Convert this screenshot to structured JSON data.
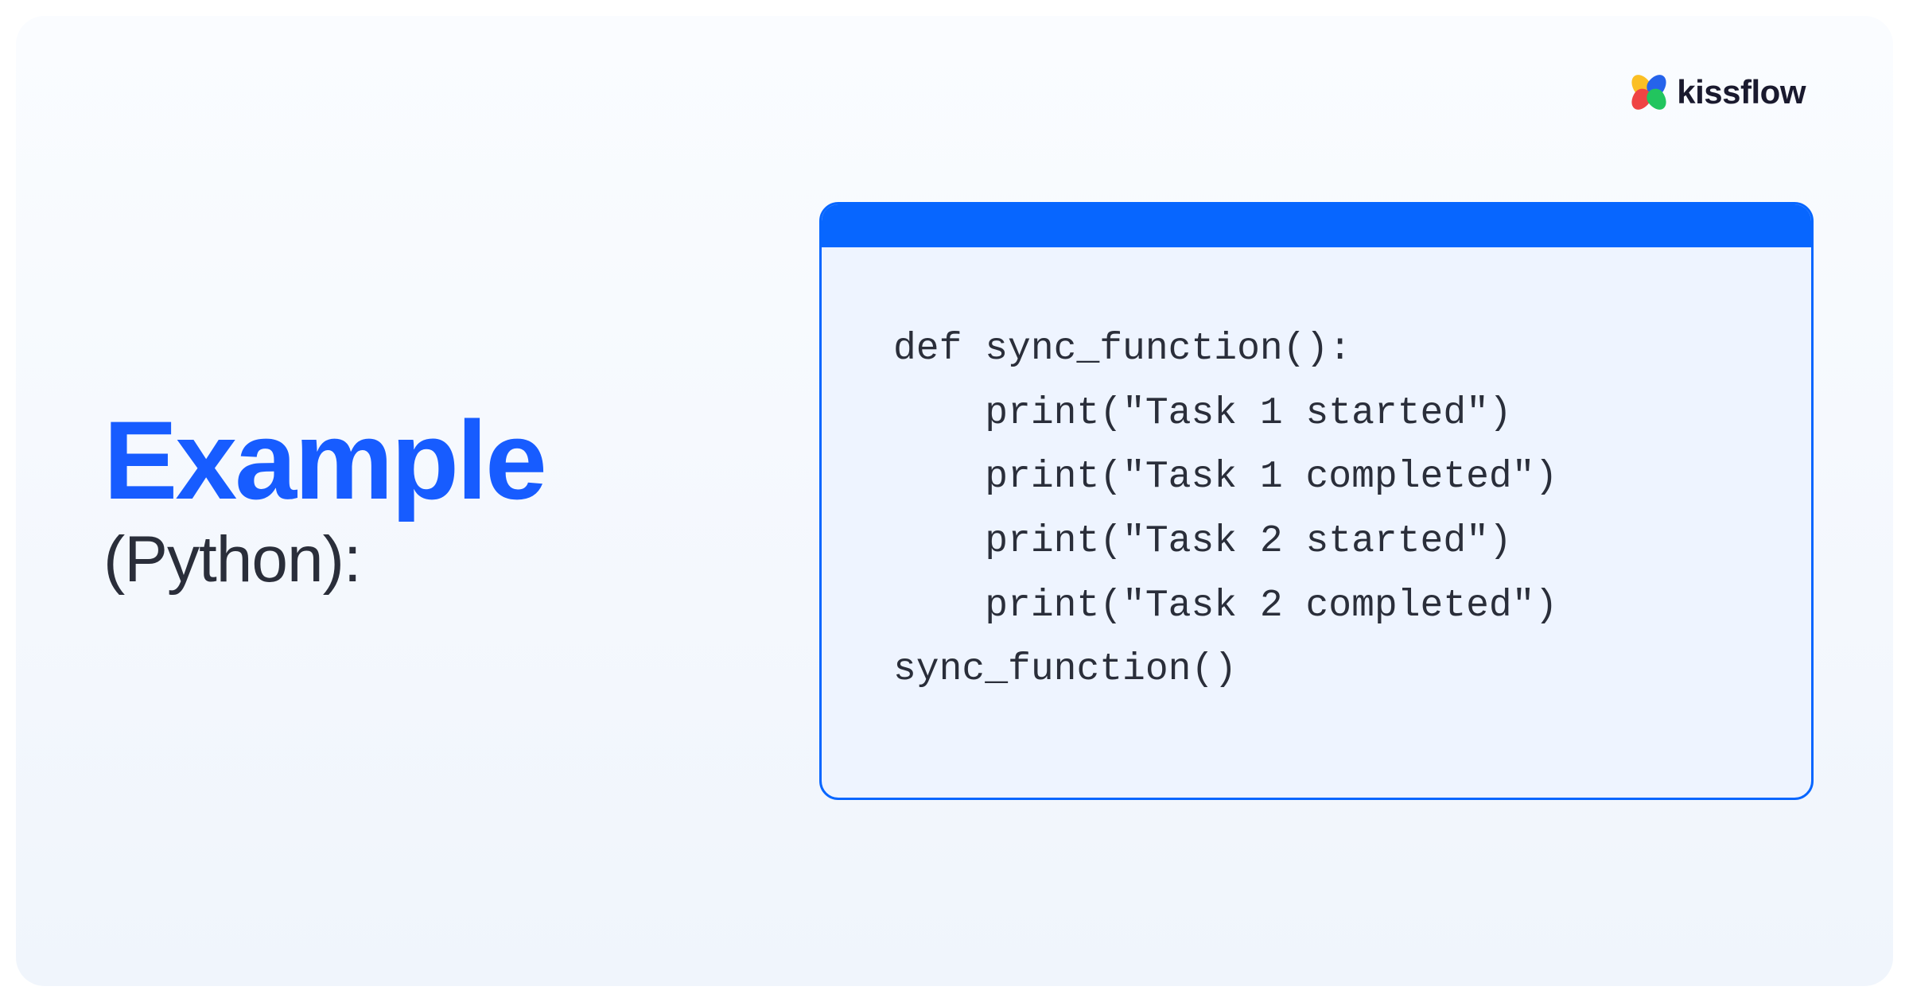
{
  "logo": {
    "text": "kissflow"
  },
  "heading": {
    "title": "Example",
    "subtitle": "(Python):"
  },
  "code": {
    "lines": [
      "def sync_function():",
      "    print(\"Task 1 started\")",
      "    print(\"Task 1 completed\")",
      "    print(\"Task 2 started\")",
      "    print(\"Task 2 completed\")",
      "sync_function()"
    ]
  }
}
